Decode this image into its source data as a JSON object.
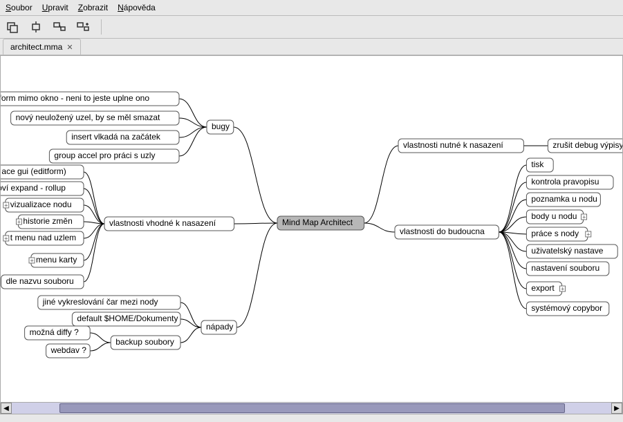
{
  "menu": {
    "file": "Soubor",
    "edit": "Upravit",
    "view": "Zobrazit",
    "help": "Nápověda"
  },
  "tab": {
    "name": "architect.mma",
    "close": "✕"
  },
  "root": "Mind Map Architect",
  "left": {
    "bugy": {
      "label": "bugy",
      "children": [
        "editform mimo okno - neni to jeste uplne ono",
        "nový neuložený uzel, by se měl smazat",
        "insert vlkadá na začátek",
        "group accel pro práci s uzly"
      ]
    },
    "vhodne": {
      "label": "vlastnosti vhodné k nasazení",
      "children": [
        "ace gui (editform)",
        "oví expand - rollup",
        "vizualizace nodu",
        "historie změn",
        "t menu nad uzlem",
        "menu karty",
        "dle nazvu souboru"
      ]
    },
    "napady": {
      "label": "nápady",
      "children": [
        "jiné vykreslování čar mezi nody",
        "default $HOME/Dokumenty",
        "backup soubory"
      ],
      "backup": [
        "možná diffy ?",
        "webdav ?"
      ]
    }
  },
  "right": {
    "nutne": {
      "label": "vlastnosti nutné k nasazení",
      "children": [
        "zrušit debug výpisy"
      ]
    },
    "budoucna": {
      "label": "vlastnosti do budoucna",
      "children": [
        "tisk",
        "kontrola pravopisu",
        "poznamka u nodu",
        "body u nodu",
        "práce s nody",
        "uživatelský nastave",
        "nastavení souboru",
        "export",
        "systémový copybor"
      ]
    }
  }
}
